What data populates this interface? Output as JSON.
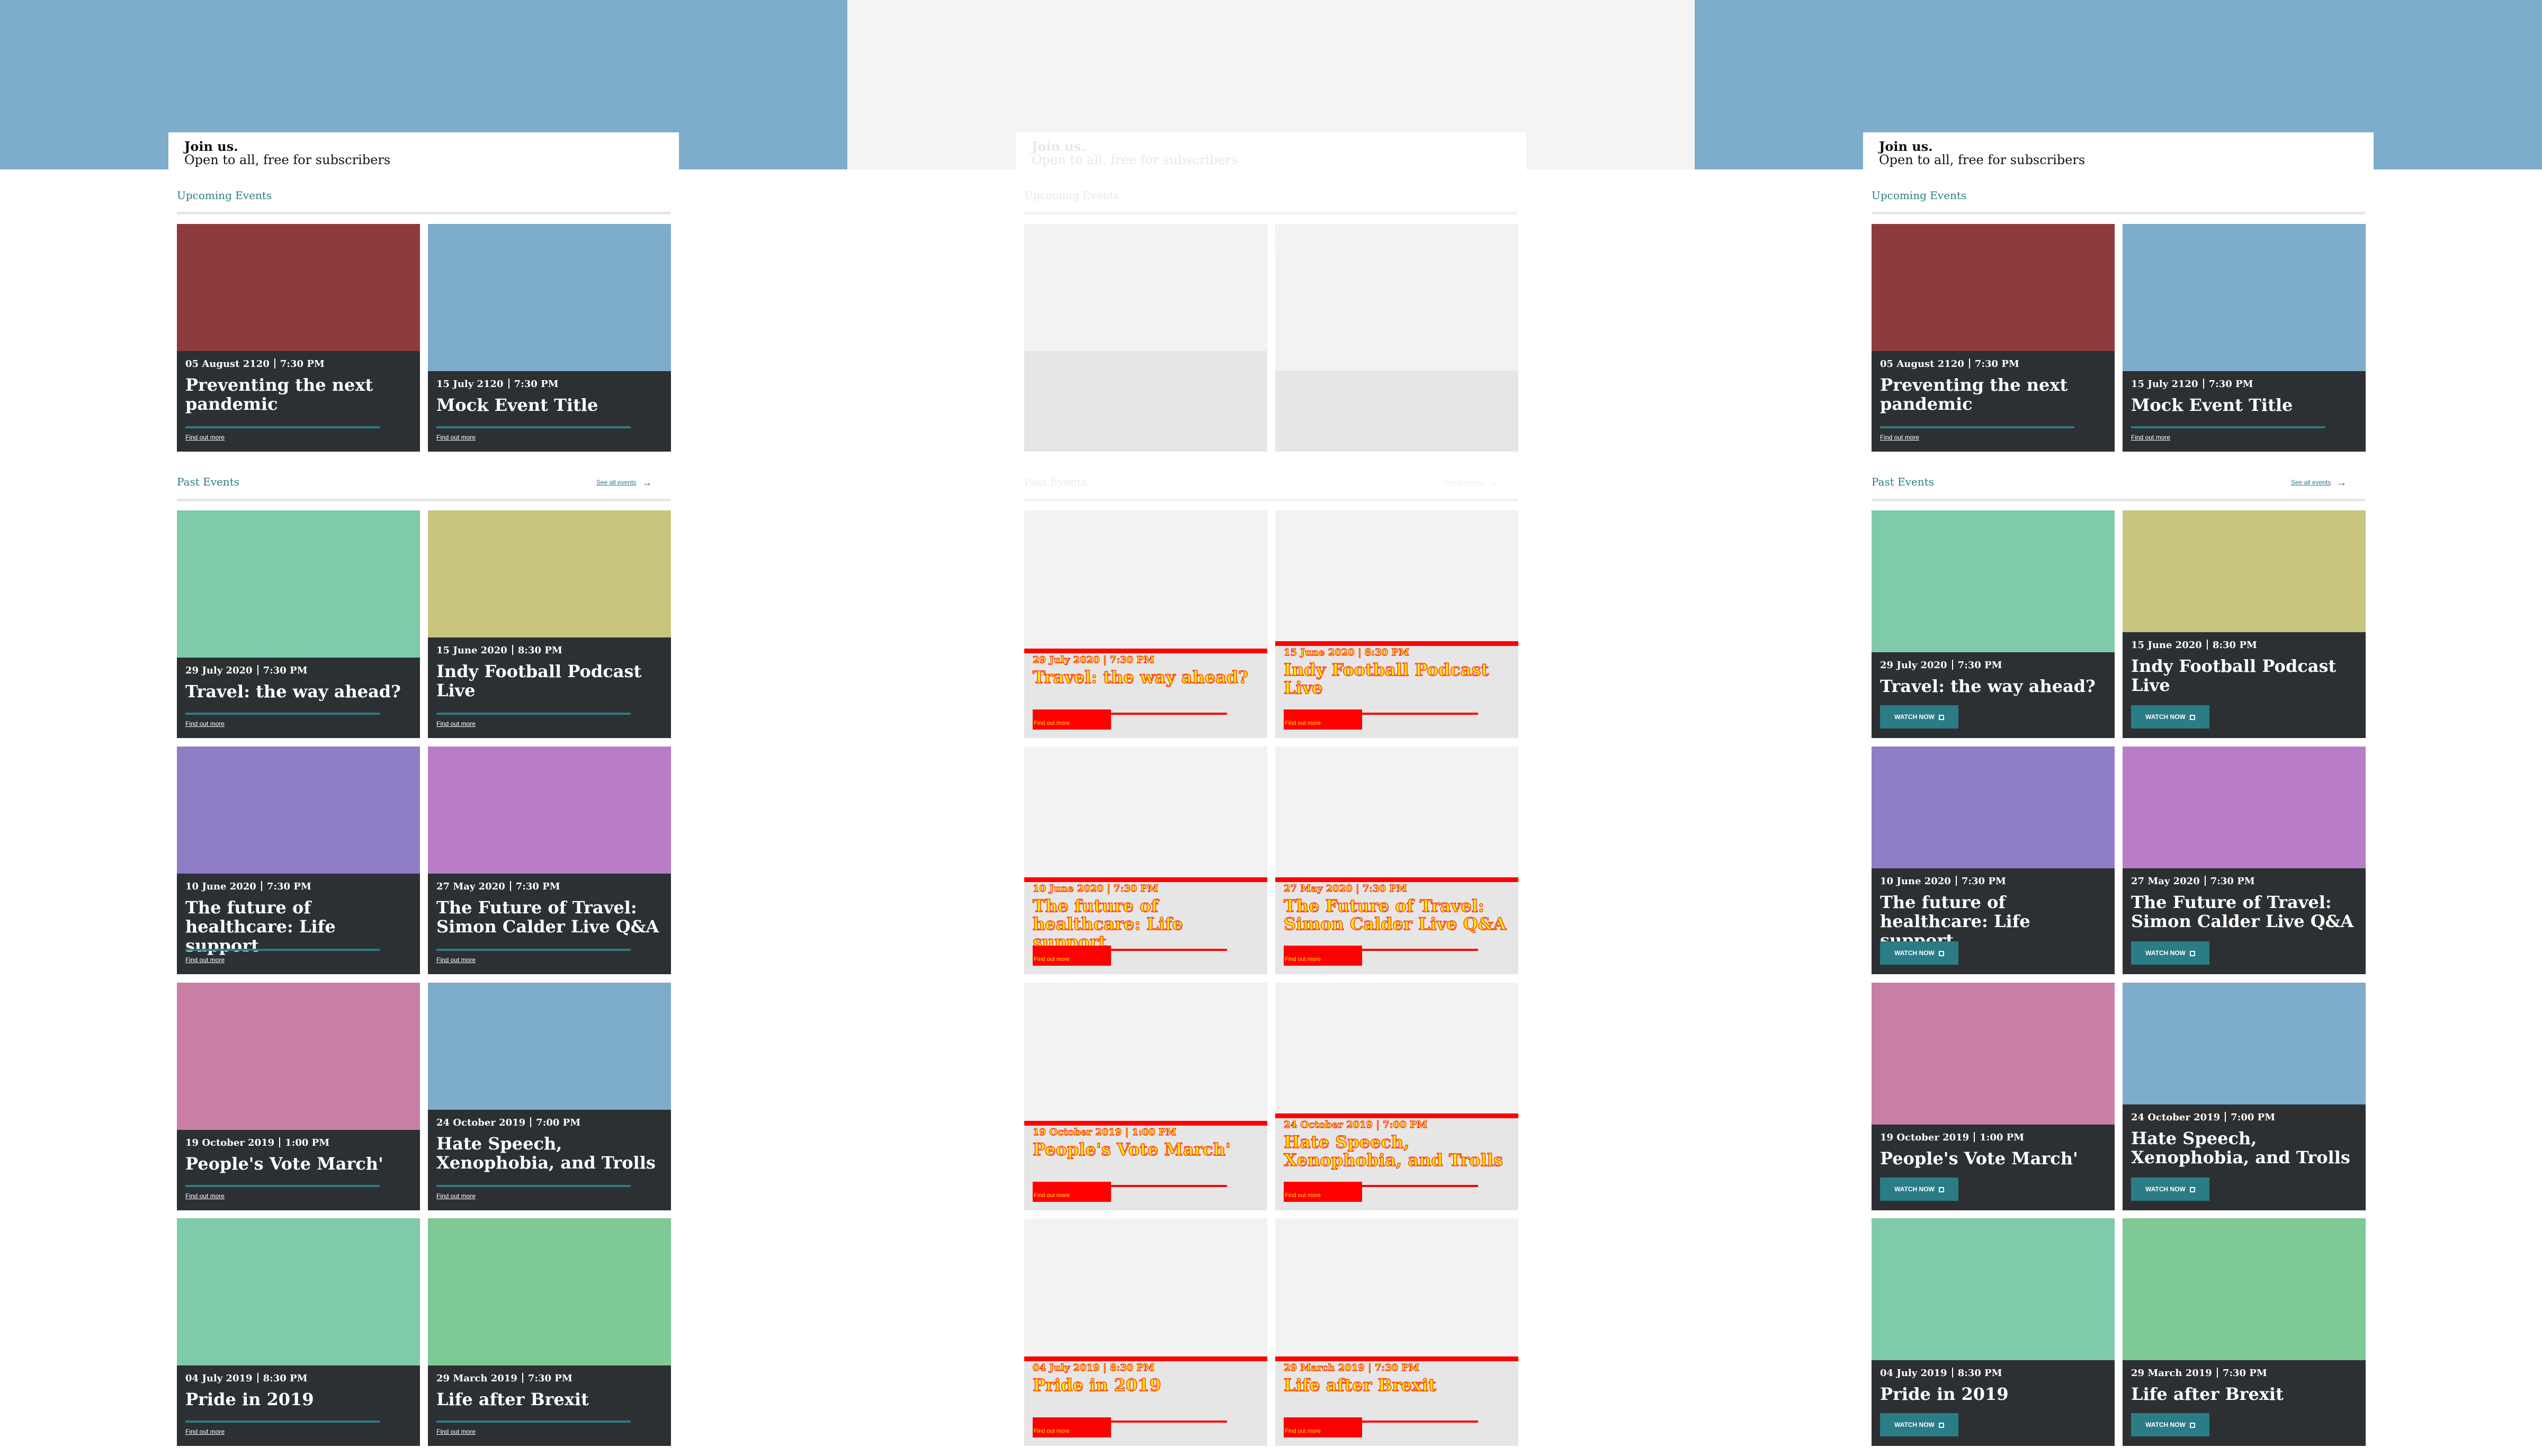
{
  "header": {
    "line1": "Join us.",
    "line2": "Open to all, free for subscribers"
  },
  "upcoming_title": "Upcoming Events",
  "past_title": "Past Events",
  "see_all": "See all events",
  "find_out_more": "Find out more",
  "watch_now": "WATCH NOW",
  "colors": {
    "hero": "#7eaccb",
    "hero_ghost": "#f4f4f4",
    "accent": "#2a7c86",
    "overlay": "#2d3033"
  },
  "upcoming": [
    {
      "date": "05 August 2120",
      "time": "7:30 PM",
      "title": "Preventing the next pandemic",
      "color": "#8e3b3d"
    },
    {
      "date": "15 July 2120",
      "time": "7:30 PM",
      "title": "Mock Event Title",
      "color": "#7eaccb"
    }
  ],
  "past": [
    {
      "date": "29 July 2020",
      "time": "7:30 PM",
      "title": "Travel: the way ahead?",
      "color": "#7ecaa9"
    },
    {
      "date": "15 June 2020",
      "time": "8:30 PM",
      "title": "Indy Football Podcast Live",
      "color": "#c8c67d"
    },
    {
      "date": "10 June 2020",
      "time": "7:30 PM",
      "title": "The future of healthcare: Life support",
      "color": "#8f7dc6"
    },
    {
      "date": "27 May 2020",
      "time": "7:30 PM",
      "title": "The Future of Travel: Simon Calder Live Q&A",
      "color": "#b97dc8"
    },
    {
      "date": "19 October 2019",
      "time": "1:00 PM",
      "title": "People's Vote March'",
      "color": "#c97ea6"
    },
    {
      "date": "24 October 2019",
      "time": "7:00 PM",
      "title": "Hate Speech, Xenophobia, and Trolls",
      "color": "#7eaccb"
    },
    {
      "date": "04 July 2019",
      "time": "8:30 PM",
      "title": "Pride in 2019",
      "color": "#7ecaa9"
    },
    {
      "date": "29 March 2019",
      "time": "7:30 PM",
      "title": "Life after Brexit",
      "color": "#7ec996"
    }
  ]
}
